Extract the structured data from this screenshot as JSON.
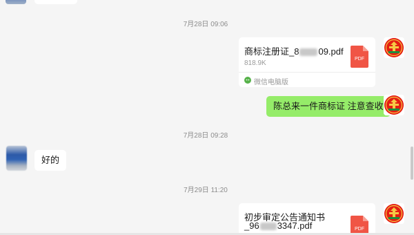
{
  "timestamps": {
    "t1": "7月28日 09:06",
    "t2": "7月28日 09:28",
    "t3": "7月29日 11:20"
  },
  "messages": {
    "file1": {
      "name_prefix": "商标注册证_8",
      "name_suffix": "09.pdf",
      "size": "818.9K",
      "source": "微信电脑版",
      "icon_label": "PDF"
    },
    "text_sent": "陈总来一件商标证 注意查收",
    "reply": "好的",
    "file2": {
      "title": "初步审定公告通知书",
      "name_prefix": "_96",
      "name_suffix": "3347.pdf",
      "icon_label": "PDF"
    }
  },
  "colors": {
    "bubble_sent": "#95ec69",
    "bubble_received": "#ffffff",
    "pdf_red": "#f05545",
    "background": "#f5f5f5"
  },
  "icons": [
    "pdf-file-icon",
    "wechat-pc-icon",
    "brand-logo-avatar"
  ]
}
